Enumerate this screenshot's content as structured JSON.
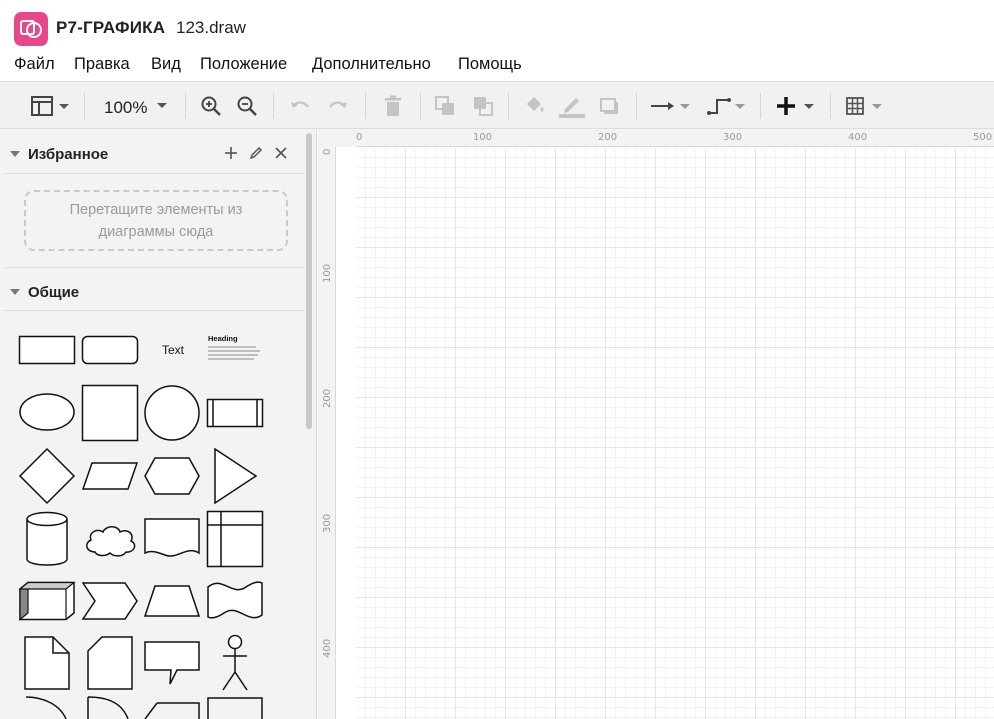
{
  "app": {
    "name": "Р7-ГРАФИКА",
    "file": "123.draw",
    "accent": "#e8488a"
  },
  "menu": {
    "items": [
      {
        "label": "Файл"
      },
      {
        "label": "Правка"
      },
      {
        "label": "Вид"
      },
      {
        "label": "Положение"
      },
      {
        "label": "Дополнительно"
      },
      {
        "label": "Помощь"
      }
    ]
  },
  "toolbar": {
    "zoom": "100%",
    "icons": [
      "format-panel-icon",
      "zoom-in-icon",
      "zoom-out-icon",
      "undo-icon",
      "redo-icon",
      "delete-icon",
      "to-front-icon",
      "to-back-icon",
      "fill-color-icon",
      "line-color-icon",
      "shadow-icon",
      "connection-icon",
      "waypoints-icon",
      "insert-icon",
      "table-icon"
    ]
  },
  "sidebar": {
    "favorites": {
      "title": "Избранное",
      "drop_hint_line1": "Перетащите элементы из",
      "drop_hint_line2": "диаграммы сюда"
    },
    "general": {
      "title": "Общие",
      "text_shape_label": "Text",
      "heading_shape_label": "Heading"
    }
  },
  "canvas": {
    "ruler_top": [
      "0",
      "100",
      "200",
      "300",
      "400",
      "500"
    ],
    "ruler_left": [
      "0",
      "100",
      "200",
      "300",
      "400"
    ]
  }
}
